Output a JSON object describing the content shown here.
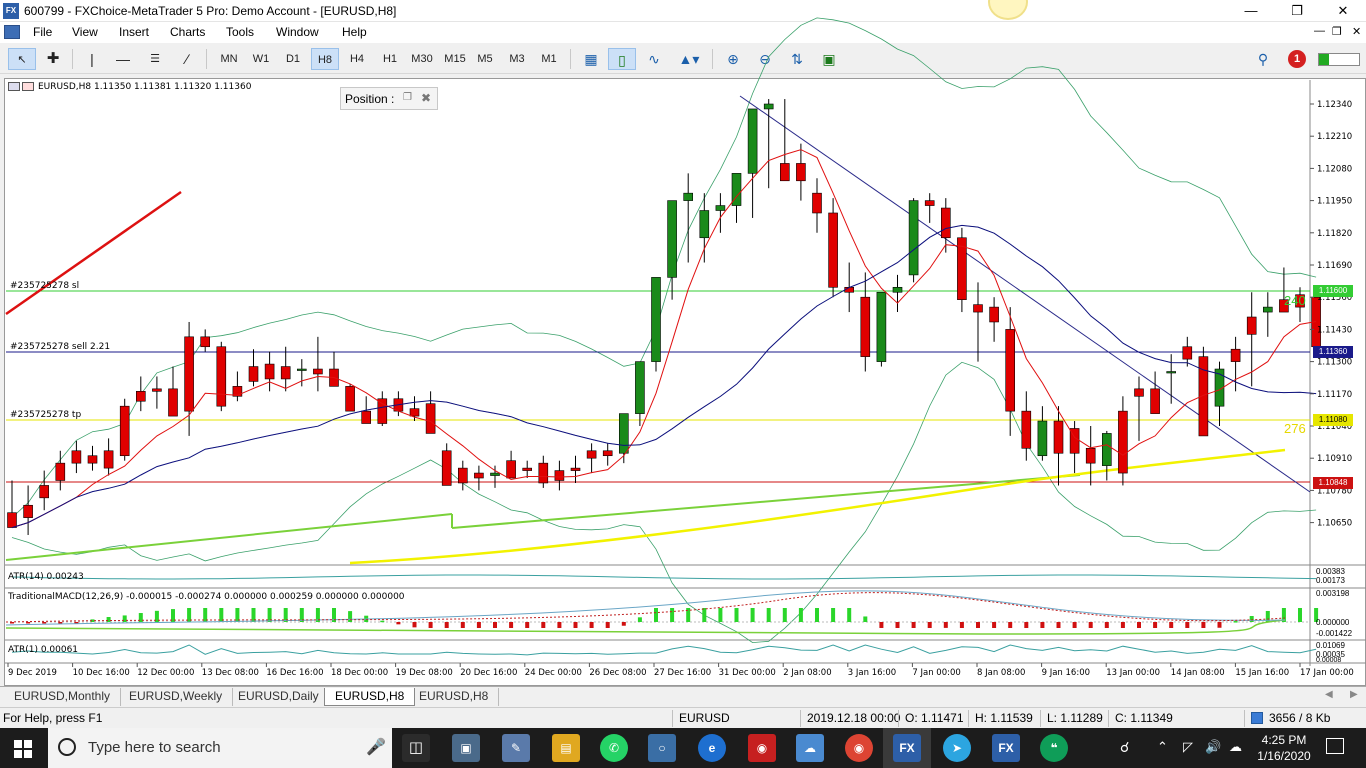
{
  "window": {
    "title": "600799 - FXChoice-MetaTrader 5 Pro: Demo Account - [EURUSD,H8]"
  },
  "menu": [
    "File",
    "View",
    "Insert",
    "Charts",
    "Tools",
    "Window",
    "Help"
  ],
  "timeframes": [
    "MN",
    "W1",
    "D1",
    "H8",
    "H4",
    "H1",
    "M30",
    "M15",
    "M5",
    "M3",
    "M1"
  ],
  "active_timeframe": "H8",
  "chart": {
    "header": "EURUSD,H8  1.11350 1.11381 1.11320 1.11360",
    "position_window_label": "Position :",
    "order_labels": {
      "sl": "#235725278 sl",
      "sell": "#235725278 sell 2.21",
      "tp": "#235725278 tp"
    },
    "line_tags": {
      "sl": "240",
      "tp": "276"
    },
    "price_ticks": [
      "1.12340",
      "1.12210",
      "1.12080",
      "1.11950",
      "1.11820",
      "1.11690",
      "1.11560",
      "1.11430",
      "1.11300",
      "1.11170",
      "1.11040",
      "1.10910",
      "1.10780",
      "1.10650"
    ],
    "price_boxes": {
      "sl": "1.11600",
      "current": "1.11360",
      "tp": "1.11080",
      "red": "1.10848"
    },
    "time_labels": [
      "9 Dec 2019",
      "10 Dec 16:00",
      "12 Dec 00:00",
      "13 Dec 08:00",
      "16 Dec 16:00",
      "18 Dec 00:00",
      "19 Dec 08:00",
      "20 Dec 16:00",
      "24 Dec 00:00",
      "26 Dec 08:00",
      "27 Dec 16:00",
      "31 Dec 00:00",
      "2 Jan 08:00",
      "3 Jan 16:00",
      "7 Jan 00:00",
      "8 Jan 08:00",
      "9 Jan 16:00",
      "13 Jan 00:00",
      "14 Jan 08:00",
      "15 Jan 16:00",
      "17 Jan 00:00"
    ]
  },
  "indicators": {
    "atr14": {
      "label": "ATR(14) 0.00243",
      "ticks": [
        "0.00383",
        "0.00173"
      ]
    },
    "macd": {
      "label": "TraditionalMACD(12,26,9) -0.000015 -0.000274 0.000000 0.000259 0.000000 0.000000",
      "ticks": [
        "0.003198",
        "0.000000",
        "-0.001422"
      ]
    },
    "atr1": {
      "label": "ATR(1) 0.00061",
      "ticks": [
        "0.01069",
        "0.00035",
        "0.00008"
      ]
    }
  },
  "tabs": [
    "EURUSD,Monthly",
    "EURUSD,Weekly",
    "EURUSD,Daily",
    "EURUSD,H8",
    "EURUSD,H8"
  ],
  "active_tab_index": 3,
  "statusbar": {
    "help": "For Help, press F1",
    "symbol": "EURUSD",
    "datetime": "2019.12.18 00:00",
    "open": "O: 1.11471",
    "high": "H: 1.11539",
    "low": "L: 1.11289",
    "close": "C: 1.11349",
    "traffic": "3656 / 8 Kb"
  },
  "taskbar": {
    "search_placeholder": "Type here to search",
    "time": "4:25 PM",
    "date": "1/16/2020",
    "fx_label": "FX"
  },
  "notification_count": "1",
  "colors": {
    "bull": "#1a8a1a",
    "bear": "#e00000",
    "sl_line": "#33cc33",
    "tp_line": "#e6e600",
    "current_line": "#1a1a8a"
  },
  "chart_data": {
    "type": "candlestick",
    "series_candles": [
      [
        1.1069,
        1.1082,
        1.1066,
        1.1063
      ],
      [
        1.1072,
        1.108,
        1.106,
        1.1067
      ],
      [
        1.108,
        1.1086,
        1.107,
        1.1075
      ],
      [
        1.1089,
        1.1094,
        1.1078,
        1.1082
      ],
      [
        1.1094,
        1.1098,
        1.1085,
        1.1089
      ],
      [
        1.1092,
        1.1096,
        1.1086,
        1.1089
      ],
      [
        1.1094,
        1.1099,
        1.1084,
        1.1087
      ],
      [
        1.1112,
        1.1115,
        1.109,
        1.1092
      ],
      [
        1.1118,
        1.1124,
        1.111,
        1.1114
      ],
      [
        1.1119,
        1.1124,
        1.1111,
        1.1118
      ],
      [
        1.1119,
        1.1128,
        1.111,
        1.1108
      ],
      [
        1.114,
        1.1146,
        1.11,
        1.111
      ],
      [
        1.114,
        1.1143,
        1.1134,
        1.1136
      ],
      [
        1.1136,
        1.1138,
        1.111,
        1.1112
      ],
      [
        1.112,
        1.1126,
        1.1114,
        1.1116
      ],
      [
        1.1128,
        1.1135,
        1.112,
        1.1122
      ],
      [
        1.1129,
        1.1134,
        1.1118,
        1.1123
      ],
      [
        1.1128,
        1.1136,
        1.1118,
        1.1123
      ],
      [
        1.1127,
        1.1131,
        1.112,
        1.1127
      ],
      [
        1.1127,
        1.114,
        1.1118,
        1.1125
      ],
      [
        1.1127,
        1.1134,
        1.112,
        1.112
      ],
      [
        1.112,
        1.1121,
        1.111,
        1.111
      ],
      [
        1.111,
        1.1116,
        1.1106,
        1.1105
      ],
      [
        1.1115,
        1.1118,
        1.1104,
        1.1105
      ],
      [
        1.1115,
        1.1118,
        1.1108,
        1.111
      ],
      [
        1.1111,
        1.1116,
        1.1106,
        1.1108
      ],
      [
        1.1113,
        1.1118,
        1.1108,
        1.1101
      ],
      [
        1.1094,
        1.1097,
        1.1081,
        1.108
      ],
      [
        1.1087,
        1.109,
        1.1078,
        1.1081
      ],
      [
        1.1085,
        1.1088,
        1.1078,
        1.1083
      ],
      [
        1.1084,
        1.1088,
        1.1079,
        1.1085
      ],
      [
        1.109,
        1.1094,
        1.1084,
        1.1083
      ],
      [
        1.1087,
        1.109,
        1.1083,
        1.1086
      ],
      [
        1.1089,
        1.1092,
        1.1079,
        1.1081
      ],
      [
        1.1086,
        1.109,
        1.1078,
        1.1082
      ],
      [
        1.1087,
        1.1092,
        1.1081,
        1.1086
      ],
      [
        1.1094,
        1.1097,
        1.1085,
        1.1091
      ],
      [
        1.1094,
        1.1097,
        1.1088,
        1.1092
      ],
      [
        1.1093,
        1.11,
        1.1089,
        1.1109
      ],
      [
        1.1109,
        1.1117,
        1.1104,
        1.113
      ],
      [
        1.113,
        1.1139,
        1.1126,
        1.1164
      ],
      [
        1.1164,
        1.1182,
        1.1155,
        1.1195
      ],
      [
        1.1195,
        1.1206,
        1.117,
        1.1198
      ],
      [
        1.118,
        1.1198,
        1.117,
        1.1191
      ],
      [
        1.1191,
        1.1198,
        1.1182,
        1.1193
      ],
      [
        1.1193,
        1.12,
        1.1186,
        1.1206
      ],
      [
        1.1206,
        1.1212,
        1.1188,
        1.1232
      ],
      [
        1.1232,
        1.1236,
        1.12,
        1.1234
      ],
      [
        1.121,
        1.1236,
        1.1205,
        1.1203
      ],
      [
        1.121,
        1.1218,
        1.1195,
        1.1203
      ],
      [
        1.1198,
        1.1204,
        1.1182,
        1.119
      ],
      [
        1.119,
        1.1196,
        1.1156,
        1.116
      ],
      [
        1.116,
        1.117,
        1.115,
        1.1158
      ],
      [
        1.1156,
        1.1166,
        1.1126,
        1.1132
      ],
      [
        1.113,
        1.1154,
        1.1128,
        1.1158
      ],
      [
        1.1158,
        1.1165,
        1.115,
        1.116
      ],
      [
        1.1165,
        1.1196,
        1.1162,
        1.1195
      ],
      [
        1.1195,
        1.1198,
        1.1186,
        1.1193
      ],
      [
        1.1192,
        1.1196,
        1.1174,
        1.118
      ],
      [
        1.118,
        1.1184,
        1.115,
        1.1155
      ],
      [
        1.1153,
        1.1162,
        1.113,
        1.115
      ],
      [
        1.1152,
        1.1156,
        1.1138,
        1.1146
      ],
      [
        1.1143,
        1.1152,
        1.11,
        1.111
      ],
      [
        1.111,
        1.1118,
        1.109,
        1.1095
      ],
      [
        1.1092,
        1.1112,
        1.109,
        1.1106
      ],
      [
        1.1106,
        1.1112,
        1.108,
        1.1093
      ],
      [
        1.1103,
        1.1106,
        1.1085,
        1.1093
      ],
      [
        1.1095,
        1.1104,
        1.108,
        1.1089
      ],
      [
        1.1088,
        1.1102,
        1.1082,
        1.1101
      ],
      [
        1.111,
        1.1116,
        1.108,
        1.1085
      ],
      [
        1.1119,
        1.1124,
        1.1098,
        1.1116
      ],
      [
        1.1119,
        1.1126,
        1.111,
        1.1109
      ],
      [
        1.1126,
        1.1133,
        1.1113,
        1.1126
      ],
      [
        1.1136,
        1.114,
        1.1128,
        1.1131
      ],
      [
        1.1132,
        1.1136,
        1.112,
        1.11
      ],
      [
        1.1112,
        1.113,
        1.1104,
        1.1127
      ],
      [
        1.1135,
        1.114,
        1.1118,
        1.113
      ],
      [
        1.1148,
        1.1158,
        1.112,
        1.1141
      ],
      [
        1.115,
        1.1158,
        1.114,
        1.1152
      ],
      [
        1.1155,
        1.1168,
        1.1152,
        1.115
      ],
      [
        1.1157,
        1.116,
        1.1146,
        1.1152
      ],
      [
        1.1156,
        1.1158,
        1.1132,
        1.1136
      ]
    ],
    "candle_format": "open, high, low, close (estimated); later candles approximate"
  }
}
